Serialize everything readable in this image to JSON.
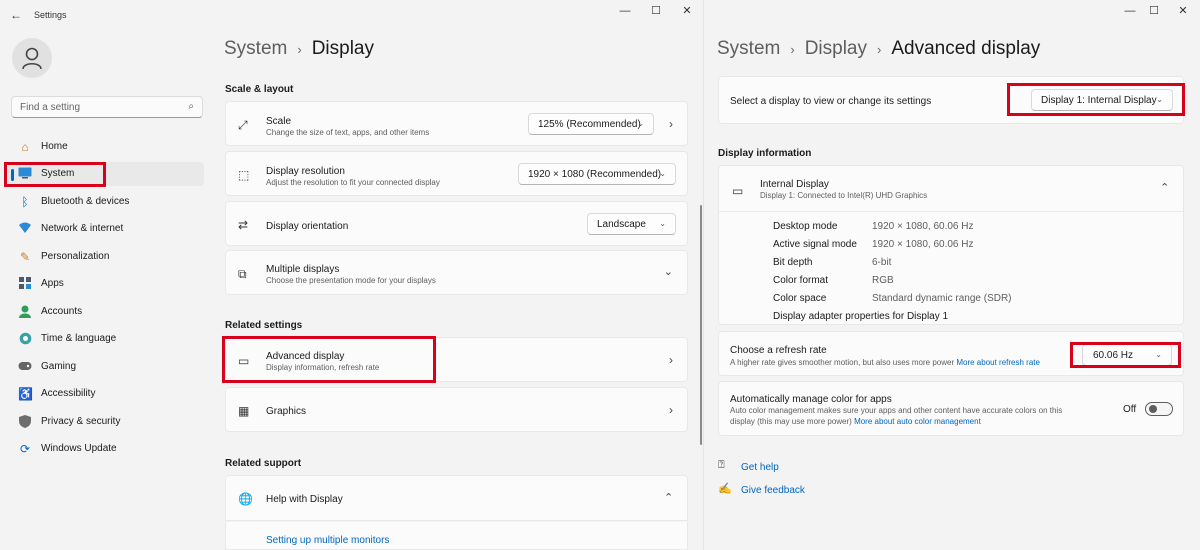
{
  "left_window": {
    "app_title": "Settings",
    "search_placeholder": "Find a setting",
    "nav": [
      {
        "label": "Home",
        "icon": "home-icon"
      },
      {
        "label": "System",
        "icon": "system-icon"
      },
      {
        "label": "Bluetooth & devices",
        "icon": "bluetooth-icon"
      },
      {
        "label": "Network & internet",
        "icon": "network-icon"
      },
      {
        "label": "Personalization",
        "icon": "brush-icon"
      },
      {
        "label": "Apps",
        "icon": "apps-icon"
      },
      {
        "label": "Accounts",
        "icon": "accounts-icon"
      },
      {
        "label": "Time & language",
        "icon": "globe-icon"
      },
      {
        "label": "Gaming",
        "icon": "gaming-icon"
      },
      {
        "label": "Accessibility",
        "icon": "accessibility-icon"
      },
      {
        "label": "Privacy & security",
        "icon": "shield-icon"
      },
      {
        "label": "Windows Update",
        "icon": "update-icon"
      }
    ],
    "breadcrumb": {
      "parent": "System",
      "current": "Display"
    },
    "scale_layout": {
      "heading": "Scale & layout",
      "scale": {
        "title": "Scale",
        "sub": "Change the size of text, apps, and other items",
        "value": "125% (Recommended)"
      },
      "resolution": {
        "title": "Display resolution",
        "sub": "Adjust the resolution to fit your connected display",
        "value": "1920 × 1080 (Recommended)"
      },
      "orientation": {
        "title": "Display orientation",
        "value": "Landscape"
      },
      "multiple": {
        "title": "Multiple displays",
        "sub": "Choose the presentation mode for your displays"
      }
    },
    "related_settings": {
      "heading": "Related settings",
      "advanced": {
        "title": "Advanced display",
        "sub": "Display information, refresh rate"
      },
      "graphics": {
        "title": "Graphics"
      }
    },
    "related_support": {
      "heading": "Related support",
      "help": {
        "title": "Help with Display"
      },
      "link": "Setting up multiple monitors"
    }
  },
  "right_window": {
    "breadcrumb": {
      "p1": "System",
      "p2": "Display",
      "current": "Advanced display"
    },
    "select_display": {
      "label": "Select a display to view or change its settings",
      "value": "Display 1: Internal Display"
    },
    "info_heading": "Display information",
    "display": {
      "title": "Internal Display",
      "sub": "Display 1: Connected to Intel(R) UHD Graphics"
    },
    "info_rows": [
      {
        "label": "Desktop mode",
        "value": "1920 × 1080, 60.06 Hz"
      },
      {
        "label": "Active signal mode",
        "value": "1920 × 1080, 60.06 Hz"
      },
      {
        "label": "Bit depth",
        "value": "6-bit"
      },
      {
        "label": "Color format",
        "value": "RGB"
      },
      {
        "label": "Color space",
        "value": "Standard dynamic range (SDR)"
      }
    ],
    "adapter_link": "Display adapter properties for Display 1",
    "refresh": {
      "title": "Choose a refresh rate",
      "sub": "A higher rate gives smoother motion, but also uses more power",
      "link": "More about refresh rate",
      "value": "60.06 Hz"
    },
    "auto_color": {
      "title": "Automatically manage color for apps",
      "sub1": "Auto color management makes sure your apps and other content have accurate colors on this",
      "sub2": "display (this may use more power)",
      "link": "More about auto color management",
      "state": "Off"
    },
    "get_help": "Get help",
    "give_feedback": "Give feedback"
  },
  "colors": {
    "accent": "#0067c0",
    "highlight": "#d9001b"
  }
}
